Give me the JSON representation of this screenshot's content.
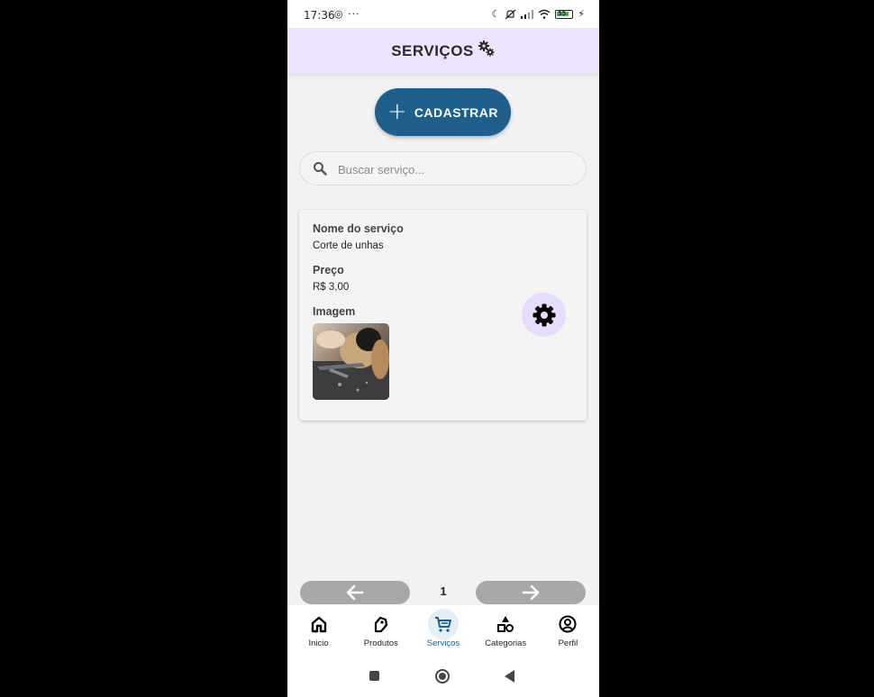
{
  "status_bar": {
    "time": "17:36",
    "left_icons": [
      "whatsapp-icon",
      "more-icon"
    ],
    "right_icons": [
      "moon-icon",
      "mute-icon",
      "signal-icon",
      "wifi-icon",
      "battery-icon"
    ],
    "battery_level": "55"
  },
  "header": {
    "title": "SERVIÇOS",
    "icon": "gears-icon"
  },
  "register_button": {
    "label": "CADASTRAR",
    "icon": "plus-icon",
    "color": "#1f5f8b"
  },
  "search": {
    "placeholder": "Buscar serviço...",
    "value": ""
  },
  "service_card": {
    "name_label": "Nome do serviço",
    "name_value": "Corte de unhas",
    "price_label": "Preço",
    "price_value": "R$ 3,00",
    "image_label": "Imagem",
    "settings_icon": "gear-icon"
  },
  "pagination": {
    "current_page": "1",
    "prev_icon": "arrow-left-icon",
    "next_icon": "arrow-right-icon"
  },
  "bottom_nav": {
    "items": [
      {
        "label": "Inicio",
        "icon": "home-icon",
        "active": false
      },
      {
        "label": "Produtos",
        "icon": "tag-icon",
        "active": false
      },
      {
        "label": "Serviços",
        "icon": "cart-icon",
        "active": true
      },
      {
        "label": "Categorias",
        "icon": "shapes-icon",
        "active": false
      },
      {
        "label": "Perfil",
        "icon": "user-circle-icon",
        "active": false
      }
    ],
    "active_color": "#1f5f8b"
  },
  "colors": {
    "header_bg": "#ede4ff",
    "accent": "#1f5f8b",
    "settings_bg": "#e7dcff"
  }
}
